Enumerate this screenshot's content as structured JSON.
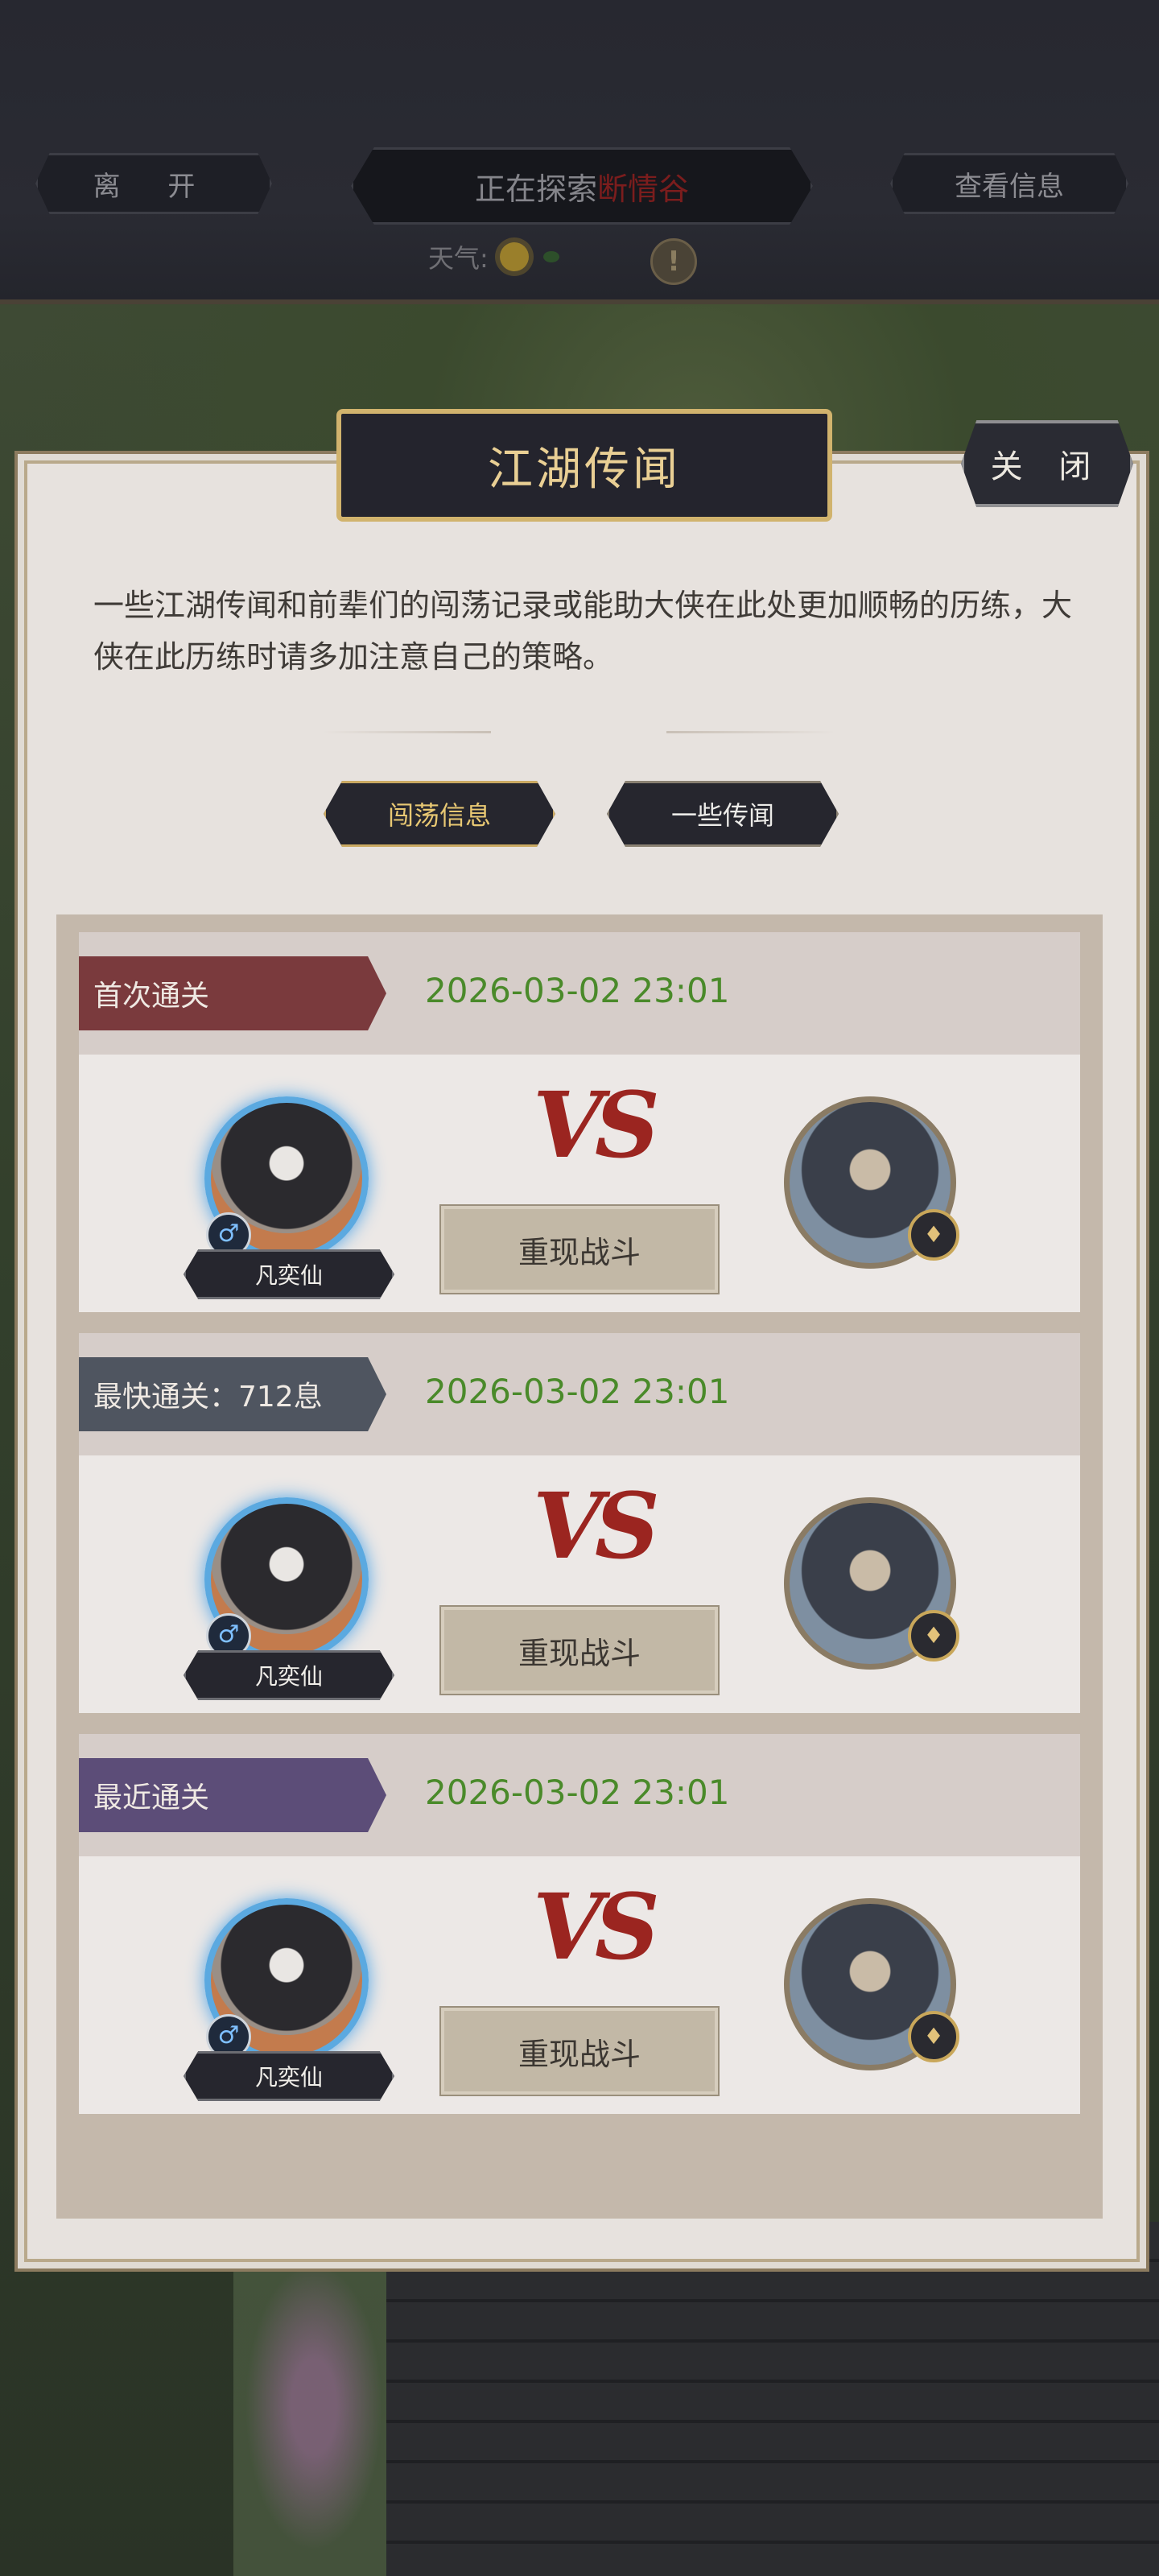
{
  "topbar": {
    "leave_label": "离 开",
    "explore_prefix": "正在探索",
    "explore_place": "断情谷",
    "info_label": "查看信息",
    "weather_label": "天气:",
    "alert_symbol": "!"
  },
  "panel": {
    "title": "江湖传闻",
    "close_label": "关 闭",
    "intro": "一些江湖传闻和前辈们的闯荡记录或能助大侠在此处更加顺畅的历练，大侠在此历练时请多加注意自己的策略。",
    "tabs": {
      "records": "闯荡信息",
      "rumors": "一些传闻"
    }
  },
  "records": [
    {
      "label": "首次通关",
      "date": "2026-03-02 23:01",
      "hero_name": "凡奕仙",
      "gender_symbol": "♂",
      "vs": "VS",
      "replay_label": "重现战斗"
    },
    {
      "label": "最快通关：712息",
      "date": "2026-03-02 23:01",
      "hero_name": "凡奕仙",
      "gender_symbol": "♂",
      "vs": "VS",
      "replay_label": "重现战斗"
    },
    {
      "label": "最近通关",
      "date": "2026-03-02 23:01",
      "hero_name": "凡奕仙",
      "gender_symbol": "♂",
      "vs": "VS",
      "replay_label": "重现战斗"
    }
  ],
  "colors": {
    "date_green": "#4a8a2a",
    "vs_red": "#9b2520",
    "title_gold": "#e9cf94",
    "place_red": "#7b1d1d"
  }
}
